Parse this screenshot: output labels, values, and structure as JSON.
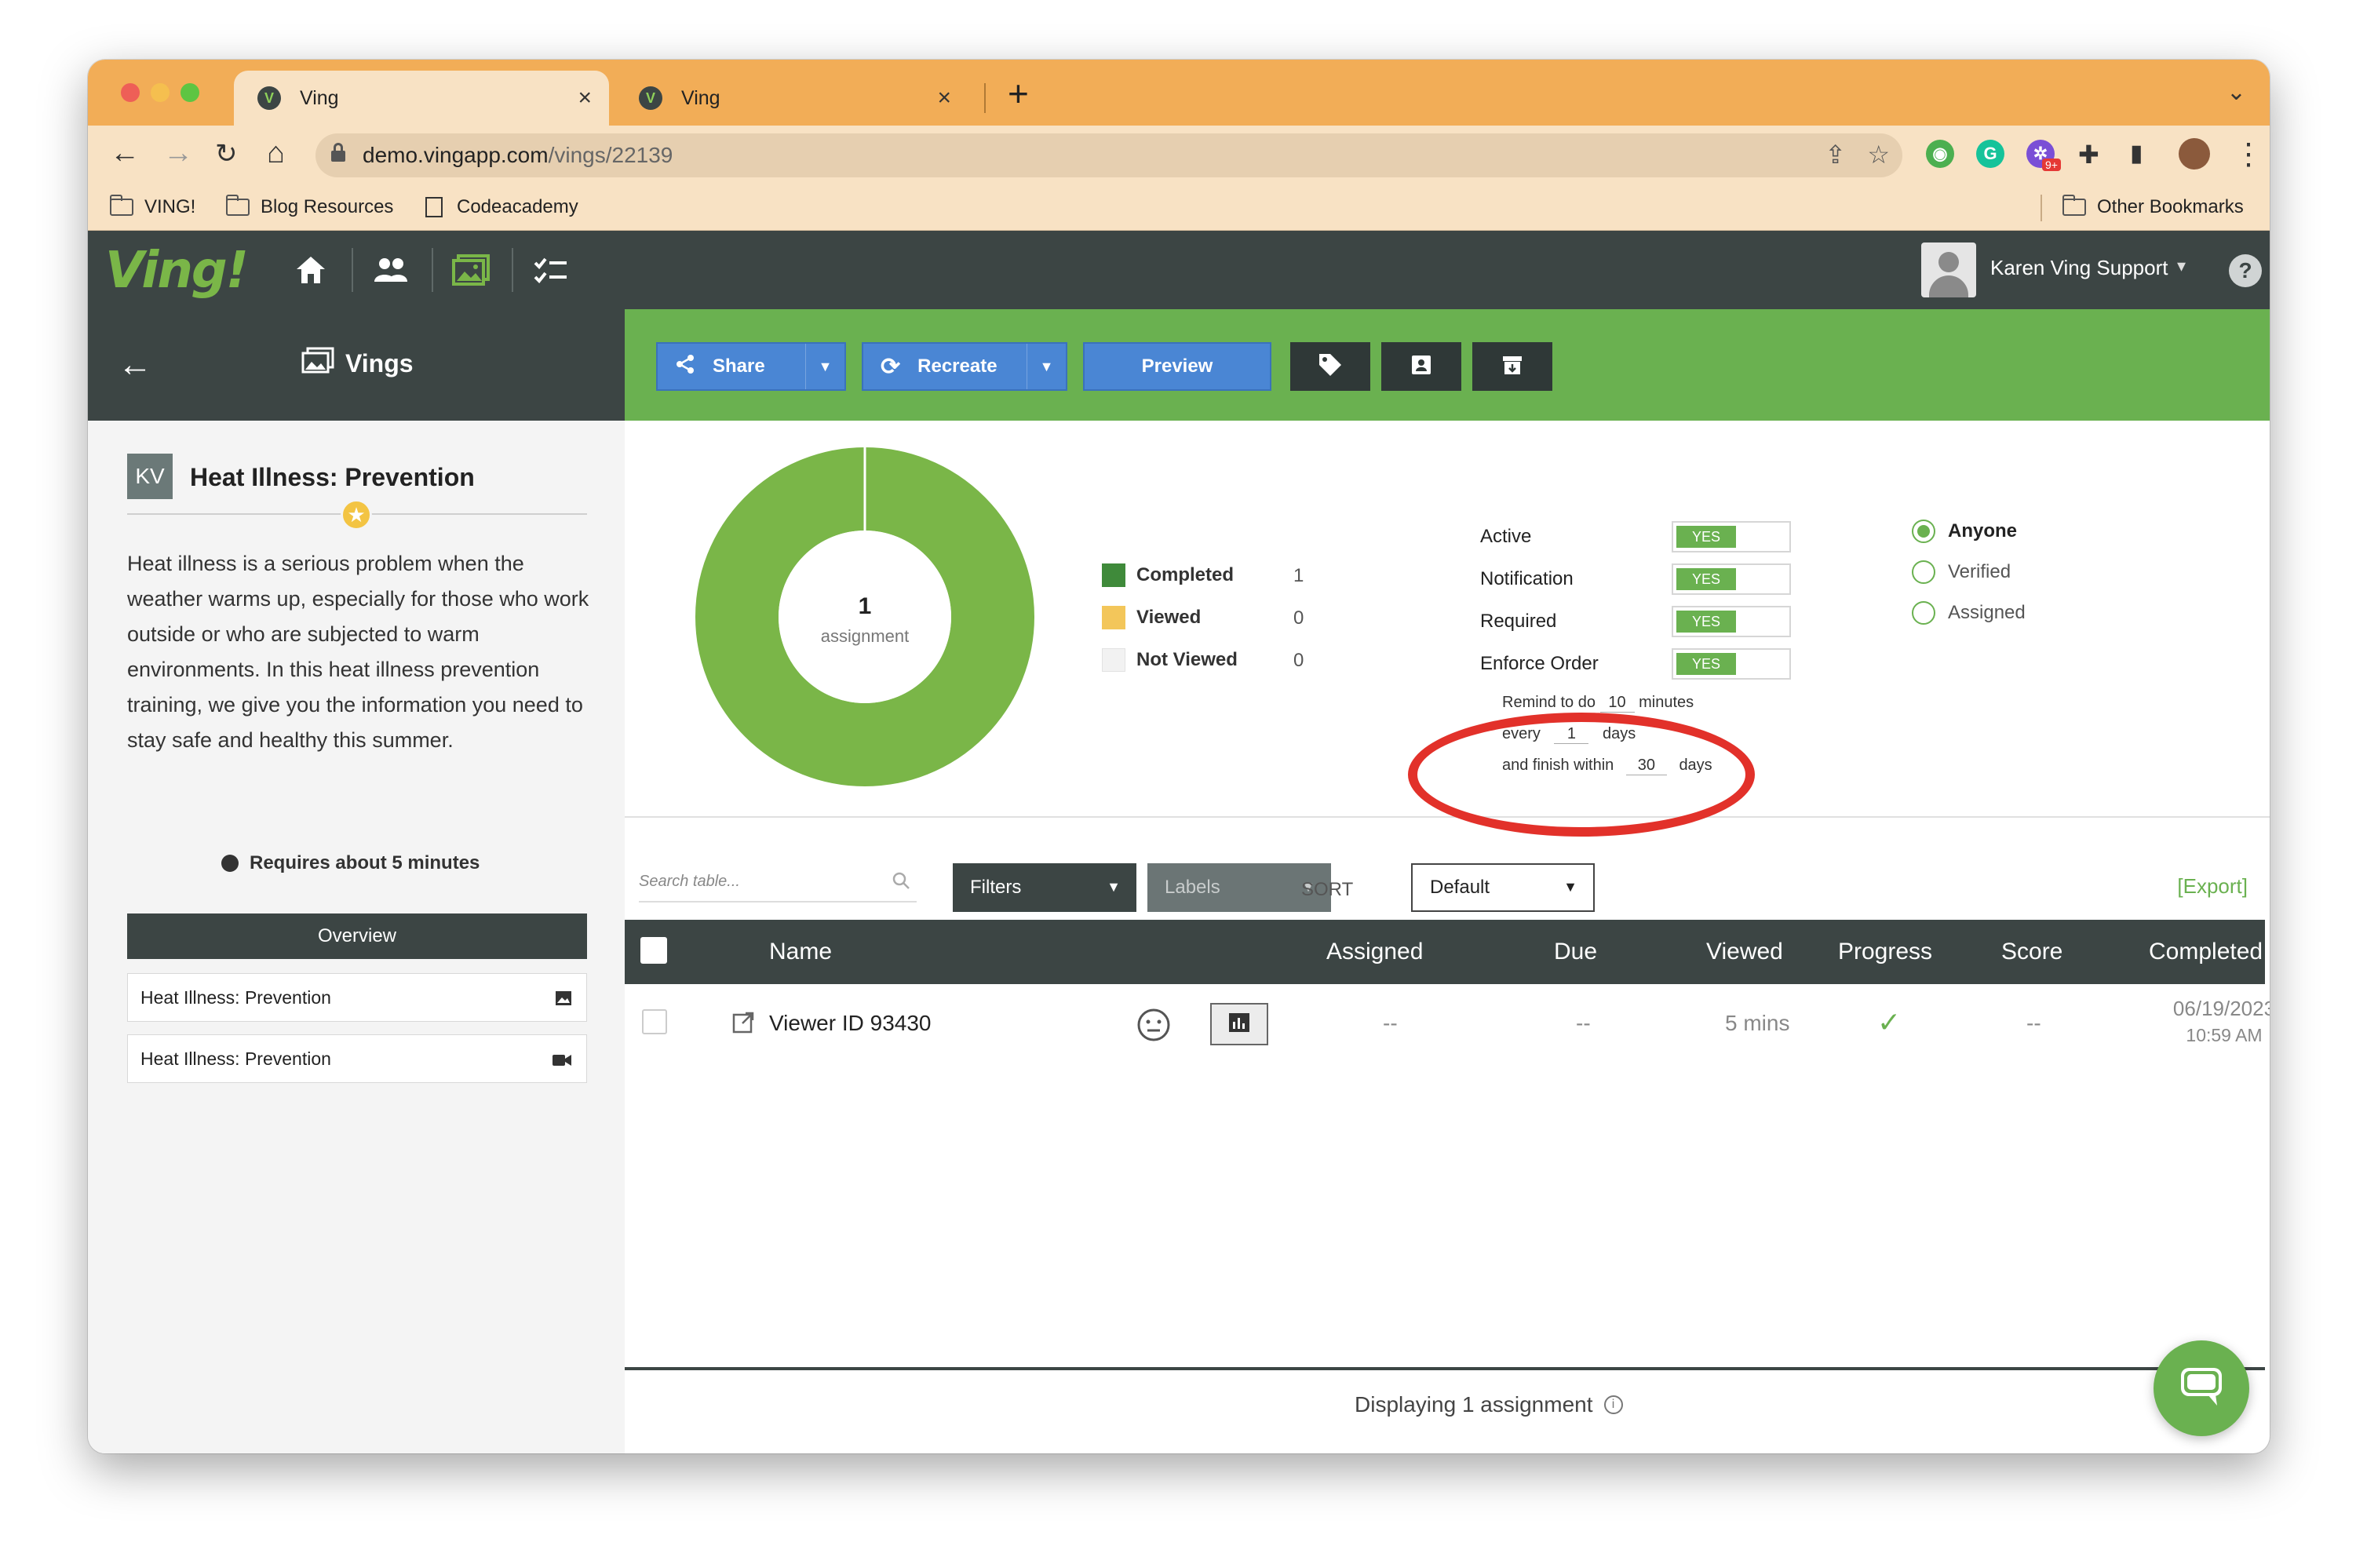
{
  "browser": {
    "tabs": [
      {
        "title": "Ving"
      },
      {
        "title": "Ving"
      }
    ],
    "favicon_letter": "V",
    "url_host": "demo.vingapp.com",
    "url_path": "/vings/22139",
    "extension_badge": "9+",
    "bookmarks": [
      {
        "label": "VING!"
      },
      {
        "label": "Blog Resources"
      },
      {
        "label": "Codeacademy"
      }
    ],
    "other_bookmarks": "Other Bookmarks"
  },
  "app": {
    "logo": "Ving!",
    "user_name": "Karen Ving Support",
    "help": "?"
  },
  "sidebar": {
    "back_label": "Vings",
    "initials": "KV",
    "title": "Heat Illness: Prevention",
    "description": "Heat illness is a serious problem when the weather warms up, especially for those who work outside or who are subjected to warm environments. In this heat illness prevention training, we give you the information you need to stay safe and healthy this summer.",
    "requires": "Requires about 5 minutes",
    "overview": "Overview",
    "contents": [
      {
        "label": "Heat Illness: Prevention",
        "icon": "image-icon"
      },
      {
        "label": "Heat Illness: Prevention",
        "icon": "video-icon"
      }
    ]
  },
  "actions": {
    "share": "Share",
    "recreate": "Recreate",
    "preview": "Preview"
  },
  "chart_data": {
    "type": "pie",
    "center_value": "1",
    "center_label": "assignment",
    "categories": [
      "Completed",
      "Viewed",
      "Not Viewed"
    ],
    "values": [
      1,
      0,
      0
    ],
    "colors": [
      "#3f8a3a",
      "#f3c65a",
      "#f2f2f2"
    ],
    "ring_color": "#7ab648"
  },
  "settings": {
    "rows": [
      {
        "label": "Active",
        "value": "YES"
      },
      {
        "label": "Notification",
        "value": "YES"
      },
      {
        "label": "Required",
        "value": "YES"
      },
      {
        "label": "Enforce Order",
        "value": "YES"
      }
    ],
    "remind_text": "Remind to do",
    "remind_value": "10",
    "remind_unit": "minutes",
    "every_label": "every",
    "every_value": "1",
    "every_unit": "days",
    "finish_label": "and finish within",
    "finish_value": "30",
    "finish_unit": "days"
  },
  "audience": {
    "options": [
      {
        "label": "Anyone",
        "selected": true
      },
      {
        "label": "Verified",
        "selected": false
      },
      {
        "label": "Assigned",
        "selected": false
      }
    ]
  },
  "filters": {
    "search_placeholder": "Search table...",
    "filters": "Filters",
    "labels": "Labels",
    "sort_label": "SORT",
    "sort_value": "Default",
    "export": "[Export]"
  },
  "table": {
    "columns": [
      "Name",
      "Assigned",
      "Due",
      "Viewed",
      "Progress",
      "Score",
      "Completed"
    ],
    "rows": [
      {
        "name": "Viewer ID 93430",
        "assigned": "--",
        "due": "--",
        "viewed": "5 mins",
        "progress": "✓",
        "score": "--",
        "completed_date": "06/19/2023",
        "completed_time": "10:59 AM"
      }
    ],
    "footer": "Displaying 1 assignment"
  }
}
